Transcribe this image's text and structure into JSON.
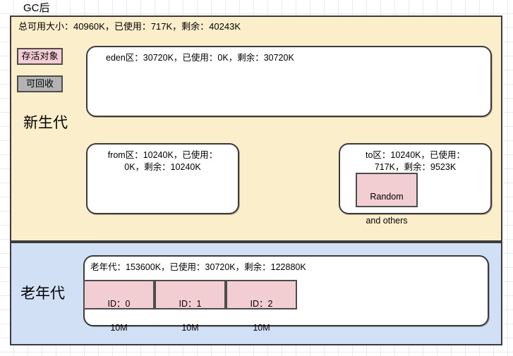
{
  "diagram": {
    "title": "GC后"
  },
  "young_generation": {
    "label": "新生代",
    "summary": "总可用大小：40960K，已使用：717K，剩余：40243K",
    "legend": [
      {
        "id": "alive",
        "label": "存活对象",
        "color": "#f4ced4"
      },
      {
        "id": "garbage",
        "label": "可回收",
        "color": "#b3b3b3"
      }
    ],
    "zones": [
      {
        "id": "eden",
        "text": "eden区：30720K，已使用：0K，剩余：30720K"
      },
      {
        "id": "from",
        "line1": "from区：10240K，已使用：",
        "line2": "0K，剩余：10240K"
      },
      {
        "id": "to",
        "line1": "to区：10240K，已使用：",
        "line2": "717K，剩余：9523K"
      }
    ],
    "objects": [
      {
        "id": "random",
        "line1": "Random",
        "line2": "and others",
        "color": "#f2cdd2"
      }
    ]
  },
  "old_generation": {
    "label": "老年代",
    "zone_text": "老年代：153600K，已使用：30720K，剩余：122880K",
    "objects": [
      {
        "id": "id0",
        "line1": "ID：0",
        "line2": "10M",
        "color": "#f2cdd2"
      },
      {
        "id": "id1",
        "line1": "ID：1",
        "line2": "10M",
        "color": "#f2cdd2"
      },
      {
        "id": "id2",
        "line1": "ID：2",
        "line2": "10M",
        "color": "#f2cdd2"
      }
    ]
  },
  "colors": {
    "young_bg": "#fbeecb",
    "old_bg": "#d2e0f6",
    "border": "#3b3b3b",
    "object_pink": "#f2cdd2",
    "legend_gray": "#b3b3b3",
    "grid": "#e6ecf7"
  }
}
